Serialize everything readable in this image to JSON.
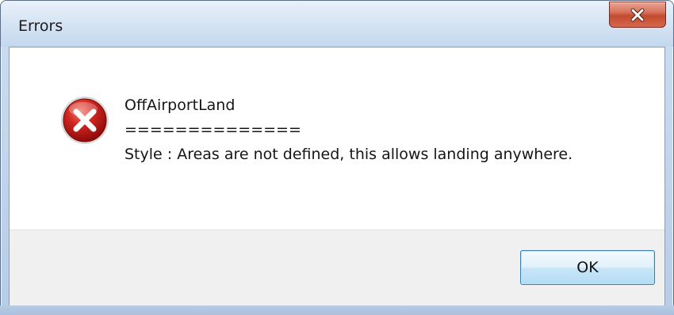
{
  "dialog": {
    "title": "Errors",
    "close_label": "X"
  },
  "message": {
    "heading": "OffAirportLand",
    "separator": "==============",
    "body": "Style : Areas are not defined, this allows landing anywhere."
  },
  "icons": {
    "status": "error-icon",
    "close": "close-icon"
  },
  "buttons": {
    "ok_label": "OK"
  },
  "colors": {
    "error_red": "#c4161c",
    "close_red": "#c24a2f",
    "button_border": "#3c7fb1"
  }
}
